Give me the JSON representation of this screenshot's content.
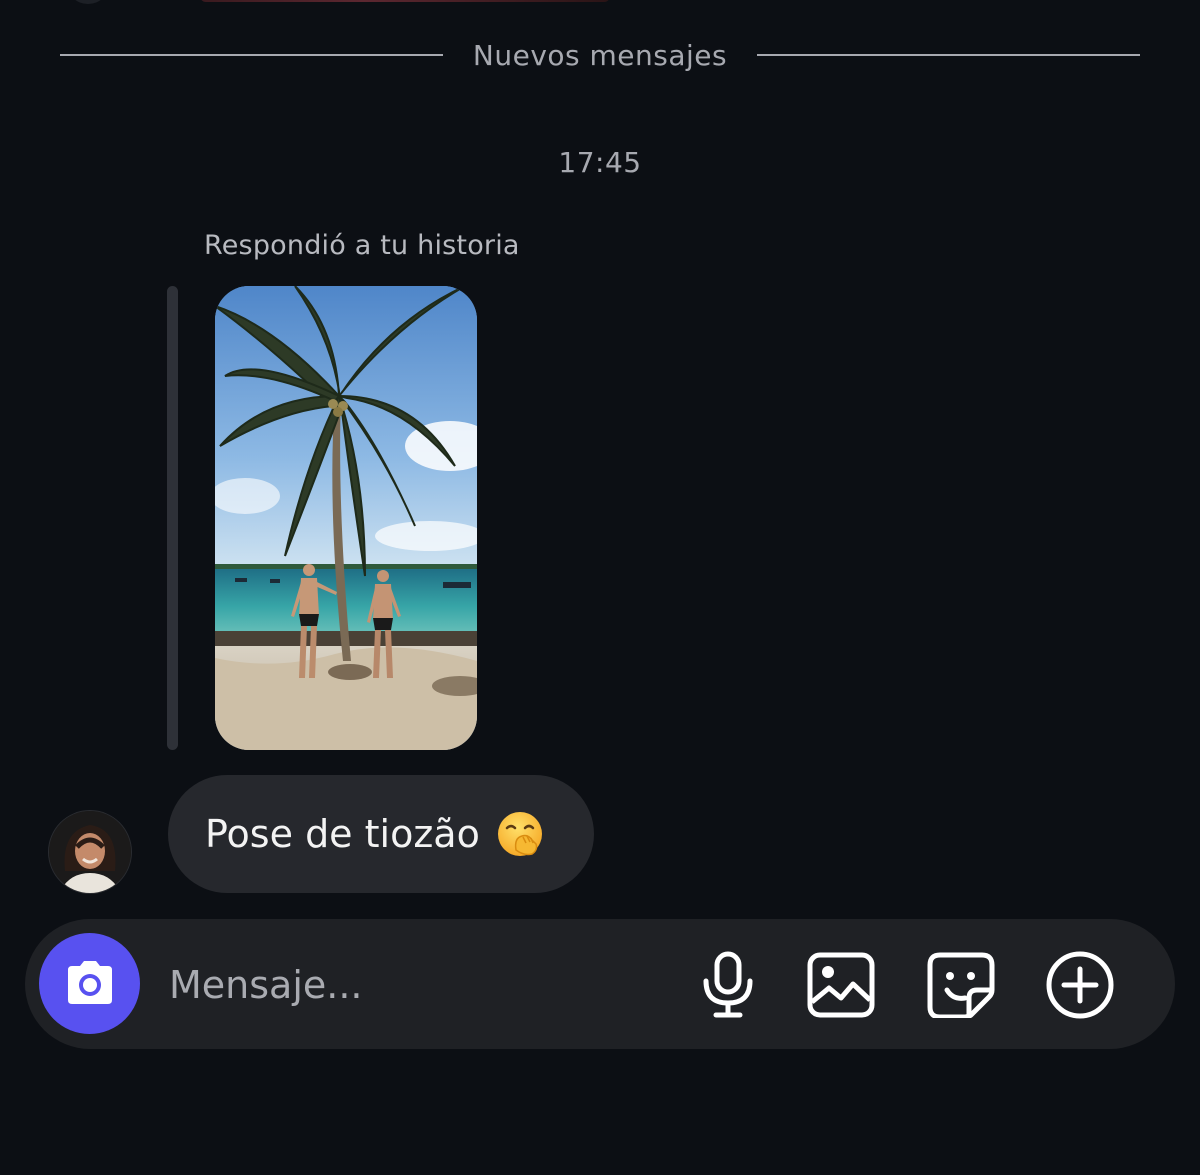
{
  "divider": {
    "label": "Nuevos mensajes"
  },
  "thread": {
    "timestamp": "17:45",
    "reply_context": "Respondió a tu historia",
    "message": {
      "text": "Pose de tiozão",
      "emoji": "🤭"
    }
  },
  "composer": {
    "placeholder": "Mensaje...",
    "icons": [
      "camera-icon",
      "microphone-icon",
      "image-icon",
      "sticker-icon",
      "add-circle-icon"
    ],
    "camera_button_color": "#5851f0"
  },
  "colors": {
    "background": "#0c0f14",
    "bubble": "#26282d",
    "composer": "#1f2125",
    "muted_text": "#a7a9b0"
  }
}
